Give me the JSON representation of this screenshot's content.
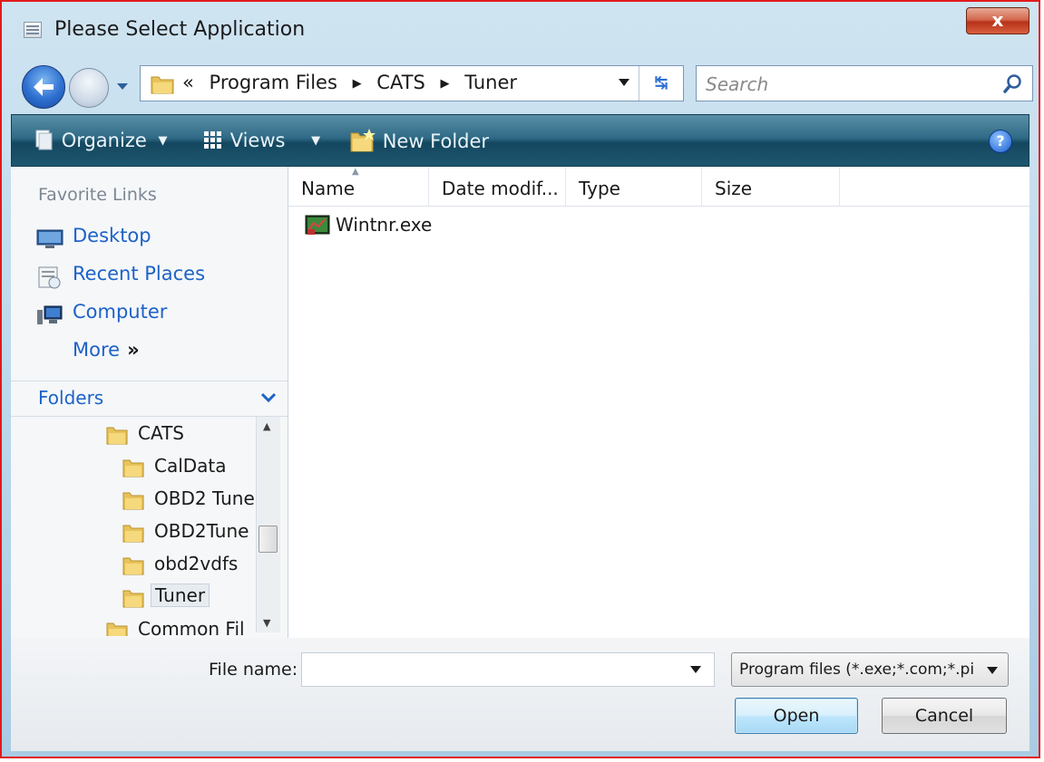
{
  "window": {
    "title": "Please Select Application",
    "close_label": "x"
  },
  "address": {
    "crumbs": [
      "Program Files",
      "CATS",
      "Tuner"
    ],
    "prefix": "«"
  },
  "search": {
    "placeholder": "Search"
  },
  "commands": {
    "organize": "Organize",
    "views": "Views",
    "new_folder": "New Folder"
  },
  "favorites": {
    "title": "Favorite Links",
    "items": [
      "Desktop",
      "Recent Places",
      "Computer"
    ],
    "more": "More"
  },
  "folders": {
    "title": "Folders",
    "tree": [
      {
        "label": "CATS"
      },
      {
        "label": "CalData"
      },
      {
        "label": "OBD2 Tune"
      },
      {
        "label": "OBD2Tune"
      },
      {
        "label": "obd2vdfs"
      },
      {
        "label": "Tuner",
        "selected": true
      },
      {
        "label": "Common Fil"
      }
    ]
  },
  "columns": [
    "Name",
    "Date modif...",
    "Type",
    "Size"
  ],
  "files": [
    {
      "name": "Wintnr.exe"
    }
  ],
  "footer": {
    "file_name_label": "File name:",
    "file_name_value": "",
    "file_type": "Program files (*.exe;*.com;*.pi",
    "open_label": "Open",
    "cancel_label": "Cancel"
  }
}
